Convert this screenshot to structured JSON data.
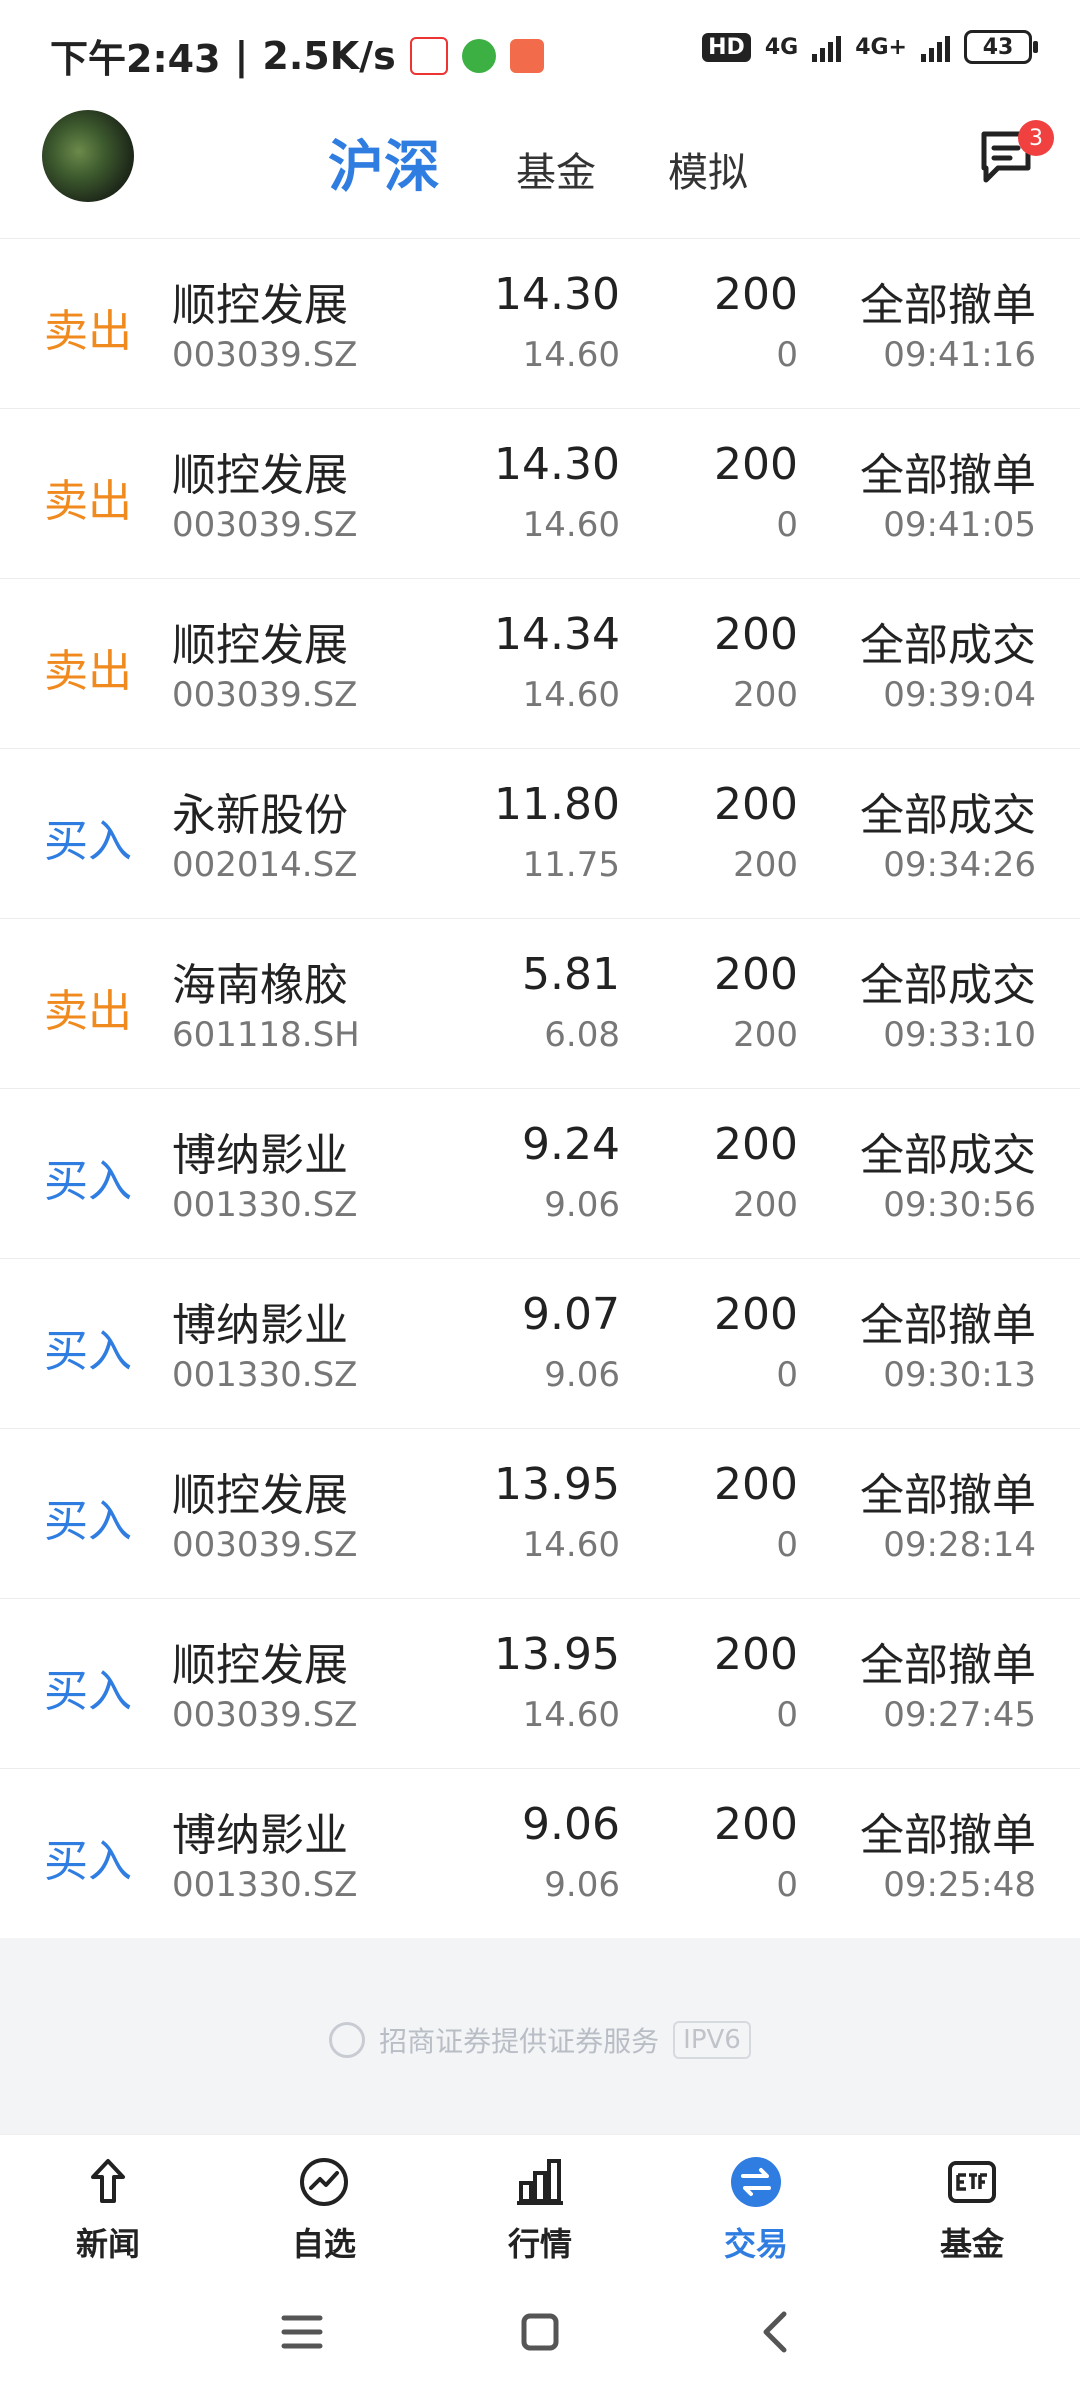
{
  "status_bar": {
    "time": "下午2:43",
    "speed": "2.5K/s",
    "hd": "HD",
    "net1": "4G",
    "net2": "4G+",
    "battery": "43"
  },
  "header": {
    "tabs": [
      "沪深",
      "基金",
      "模拟"
    ],
    "message_badge": "3"
  },
  "orders": [
    {
      "side": "卖出",
      "side_type": "sell",
      "name": "顺控发展",
      "code": "003039.SZ",
      "price": "14.30",
      "ref_price": "14.60",
      "qty": "200",
      "filled": "0",
      "status": "全部撤单",
      "time": "09:41:16"
    },
    {
      "side": "卖出",
      "side_type": "sell",
      "name": "顺控发展",
      "code": "003039.SZ",
      "price": "14.30",
      "ref_price": "14.60",
      "qty": "200",
      "filled": "0",
      "status": "全部撤单",
      "time": "09:41:05"
    },
    {
      "side": "卖出",
      "side_type": "sell",
      "name": "顺控发展",
      "code": "003039.SZ",
      "price": "14.34",
      "ref_price": "14.60",
      "qty": "200",
      "filled": "200",
      "status": "全部成交",
      "time": "09:39:04"
    },
    {
      "side": "买入",
      "side_type": "buy",
      "name": "永新股份",
      "code": "002014.SZ",
      "price": "11.80",
      "ref_price": "11.75",
      "qty": "200",
      "filled": "200",
      "status": "全部成交",
      "time": "09:34:26"
    },
    {
      "side": "卖出",
      "side_type": "sell",
      "name": "海南橡胶",
      "code": "601118.SH",
      "price": "5.81",
      "ref_price": "6.08",
      "qty": "200",
      "filled": "200",
      "status": "全部成交",
      "time": "09:33:10"
    },
    {
      "side": "买入",
      "side_type": "buy",
      "name": "博纳影业",
      "code": "001330.SZ",
      "price": "9.24",
      "ref_price": "9.06",
      "qty": "200",
      "filled": "200",
      "status": "全部成交",
      "time": "09:30:56"
    },
    {
      "side": "买入",
      "side_type": "buy",
      "name": "博纳影业",
      "code": "001330.SZ",
      "price": "9.07",
      "ref_price": "9.06",
      "qty": "200",
      "filled": "0",
      "status": "全部撤单",
      "time": "09:30:13"
    },
    {
      "side": "买入",
      "side_type": "buy",
      "name": "顺控发展",
      "code": "003039.SZ",
      "price": "13.95",
      "ref_price": "14.60",
      "qty": "200",
      "filled": "0",
      "status": "全部撤单",
      "time": "09:28:14"
    },
    {
      "side": "买入",
      "side_type": "buy",
      "name": "顺控发展",
      "code": "003039.SZ",
      "price": "13.95",
      "ref_price": "14.60",
      "qty": "200",
      "filled": "0",
      "status": "全部撤单",
      "time": "09:27:45"
    },
    {
      "side": "买入",
      "side_type": "buy",
      "name": "博纳影业",
      "code": "001330.SZ",
      "price": "9.06",
      "ref_price": "9.06",
      "qty": "200",
      "filled": "0",
      "status": "全部撤单",
      "time": "09:25:48"
    }
  ],
  "footer": {
    "provider": "招商证券提供证券服务",
    "ipv6": "IPV6"
  },
  "bottom_nav": [
    {
      "label": "新闻",
      "icon": "news-icon"
    },
    {
      "label": "自选",
      "icon": "watchlist-icon"
    },
    {
      "label": "行情",
      "icon": "market-icon"
    },
    {
      "label": "交易",
      "icon": "trade-icon",
      "active": true
    },
    {
      "label": "基金",
      "icon": "etf-icon"
    }
  ],
  "colors": {
    "accent": "#2f7de1",
    "sell": "#f08a1e",
    "buy": "#2f7de1",
    "badge": "#f04040"
  }
}
